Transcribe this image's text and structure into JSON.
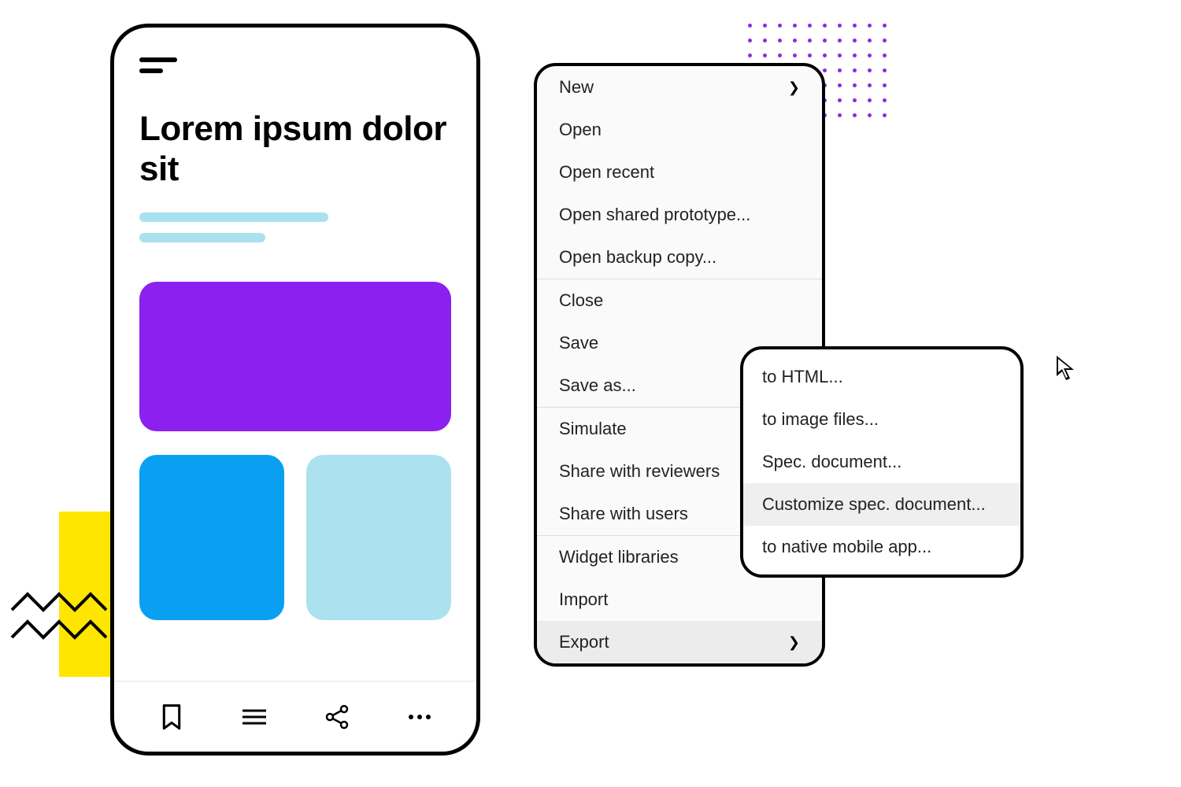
{
  "phone": {
    "headline": "Lorem ipsum dolor sit",
    "toolbar_icons": [
      "bookmark-icon",
      "list-icon",
      "share-icon",
      "more-icon"
    ]
  },
  "menu": {
    "groups": [
      [
        {
          "label": "New",
          "has_submenu": true
        },
        {
          "label": "Open"
        },
        {
          "label": "Open recent"
        },
        {
          "label": "Open shared prototype..."
        },
        {
          "label": "Open backup copy..."
        }
      ],
      [
        {
          "label": "Close"
        },
        {
          "label": "Save"
        },
        {
          "label": "Save as..."
        }
      ],
      [
        {
          "label": "Simulate"
        },
        {
          "label": "Share with reviewers"
        },
        {
          "label": "Share with users"
        }
      ],
      [
        {
          "label": "Widget libraries"
        },
        {
          "label": "Import"
        },
        {
          "label": "Export",
          "has_submenu": true,
          "active": true
        }
      ]
    ]
  },
  "submenu": {
    "items": [
      {
        "label": "to HTML..."
      },
      {
        "label": "to image files..."
      },
      {
        "label": "Spec. document..."
      },
      {
        "label": "Customize spec. document...",
        "hover": true
      },
      {
        "label": "to native mobile app..."
      }
    ]
  },
  "colors": {
    "purple": "#8b20ef",
    "blue": "#0aa0f2",
    "lightblue": "#ace1ef",
    "accent_lightblue_line": "#a9e1ef",
    "yellow": "#ffe600",
    "dot_purple": "#8a2be2"
  }
}
